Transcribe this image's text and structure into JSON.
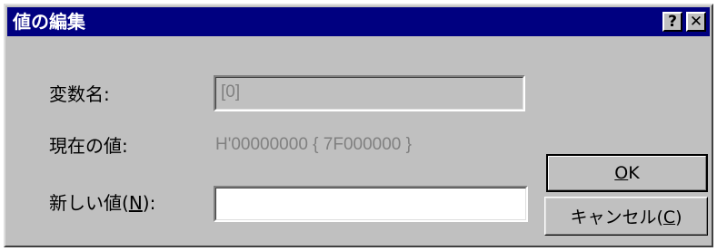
{
  "window": {
    "title": "値の編集",
    "help_glyph": "?",
    "close_glyph": "✕"
  },
  "form": {
    "variable_name_label": "変数名:",
    "variable_name_value": "[0]",
    "current_value_label": "現在の値:",
    "current_value": "H'00000000 { 7F000000 }",
    "new_value_label_prefix": "新しい値(",
    "new_value_label_mnemonic": "N",
    "new_value_label_suffix": "):",
    "new_value_input": ""
  },
  "buttons": {
    "ok_mnemonic": "O",
    "ok_rest": "K",
    "cancel_prefix": "キャンセル(",
    "cancel_mnemonic": "C",
    "cancel_suffix": ")"
  }
}
